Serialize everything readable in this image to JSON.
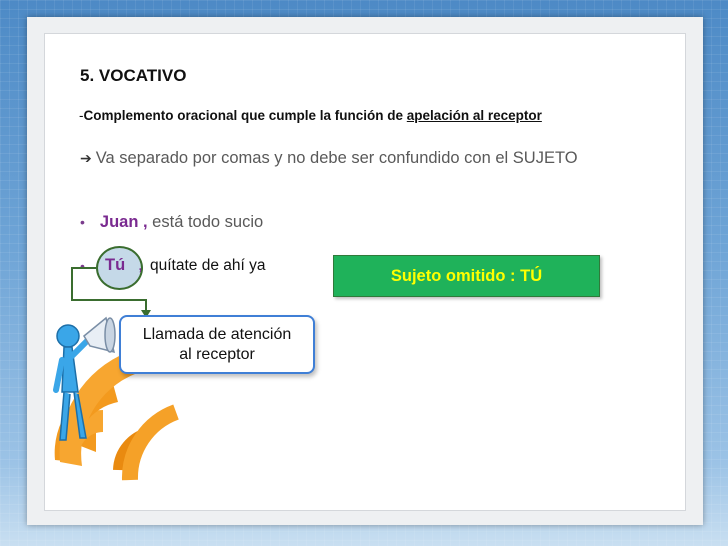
{
  "slide": {
    "title": "5.  VOCATIVO",
    "definition": {
      "dash": "-",
      "text_bold": "Complemento oracional que cumple la función de ",
      "text_underlined": "apelación al receptor"
    },
    "rule_line": "Va separado por comas y no debe ser confundido con el SUJETO",
    "example1": {
      "bullet": "•",
      "vocative": "Juan ,",
      "rest": " está todo sucio"
    },
    "example2": {
      "bullet": "•",
      "vocative": "Tú",
      "comma": ",",
      "rest": "quítate de ahí ya"
    },
    "callout_subject": "Sujeto omitido : TÚ",
    "callout_attention": {
      "line1": "Llamada de atención",
      "line2": "al receptor"
    }
  },
  "icons": {
    "arrow": "right-arrow-icon",
    "figure": "megaphone-figure-icon",
    "signal": "signal-waves-icon"
  },
  "colors": {
    "vocative": "#7a2a90",
    "subject_box": "#1fb25a",
    "subject_text": "#ffff00",
    "callout_border": "#3f7fd6",
    "waves": "#f39a1e",
    "connector": "#3a6d2f"
  }
}
